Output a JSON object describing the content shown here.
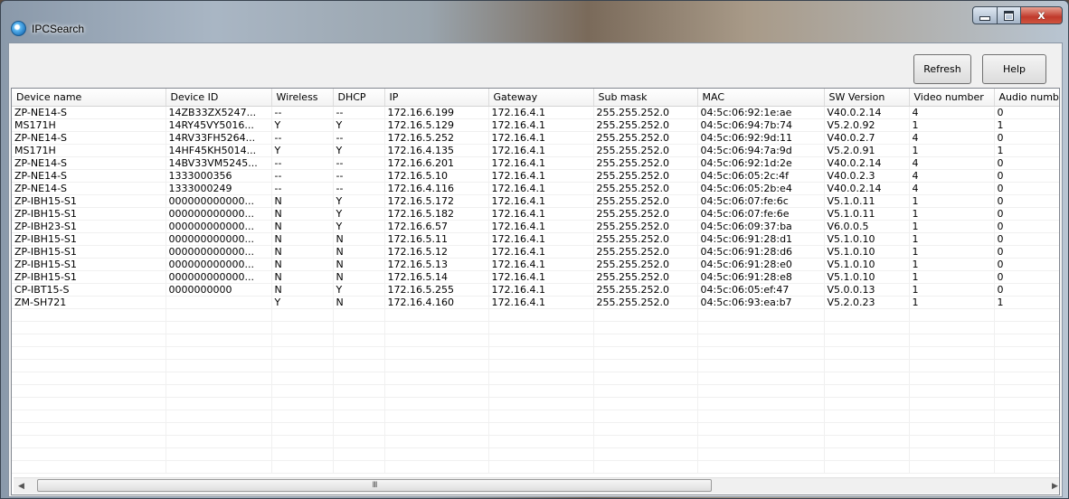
{
  "window": {
    "title": "IPCSearch",
    "close_glyph": "x"
  },
  "toolbar": {
    "refresh_label": "Refresh",
    "help_label": "Help"
  },
  "table": {
    "columns": [
      "Device name",
      "Device ID",
      "Wireless",
      "DHCP",
      "IP",
      "Gateway",
      "Sub mask",
      "MAC",
      "SW Version",
      "Video number",
      "Audio number"
    ],
    "rows": [
      [
        "ZP-NE14-S",
        "14ZB33ZX5247...",
        "--",
        "--",
        "172.16.6.199",
        "172.16.4.1",
        "255.255.252.0",
        "04:5c:06:92:1e:ae",
        "V40.0.2.14",
        "4",
        "0"
      ],
      [
        "MS171H",
        "14RY45VY5016...",
        "Y",
        "Y",
        "172.16.5.129",
        "172.16.4.1",
        "255.255.252.0",
        "04:5c:06:94:7b:74",
        "V5.2.0.92",
        "1",
        "1"
      ],
      [
        "ZP-NE14-S",
        "14RV33FH5264...",
        "--",
        "--",
        "172.16.5.252",
        "172.16.4.1",
        "255.255.252.0",
        "04:5c:06:92:9d:11",
        "V40.0.2.7",
        "4",
        "0"
      ],
      [
        "MS171H",
        "14HF45KH5014...",
        "Y",
        "Y",
        "172.16.4.135",
        "172.16.4.1",
        "255.255.252.0",
        "04:5c:06:94:7a:9d",
        "V5.2.0.91",
        "1",
        "1"
      ],
      [
        "ZP-NE14-S",
        "14BV33VM5245...",
        "--",
        "--",
        "172.16.6.201",
        "172.16.4.1",
        "255.255.252.0",
        "04:5c:06:92:1d:2e",
        "V40.0.2.14",
        "4",
        "0"
      ],
      [
        "ZP-NE14-S",
        "1333000356",
        "--",
        "--",
        "172.16.5.10",
        "172.16.4.1",
        "255.255.252.0",
        "04:5c:06:05:2c:4f",
        "V40.0.2.3",
        "4",
        "0"
      ],
      [
        "ZP-NE14-S",
        "1333000249",
        "--",
        "--",
        "172.16.4.116",
        "172.16.4.1",
        "255.255.252.0",
        "04:5c:06:05:2b:e4",
        "V40.0.2.14",
        "4",
        "0"
      ],
      [
        "ZP-IBH15-S1",
        "000000000000...",
        "N",
        "Y",
        "172.16.5.172",
        "172.16.4.1",
        "255.255.252.0",
        "04:5c:06:07:fe:6c",
        "V5.1.0.11",
        "1",
        "0"
      ],
      [
        "ZP-IBH15-S1",
        "000000000000...",
        "N",
        "Y",
        "172.16.5.182",
        "172.16.4.1",
        "255.255.252.0",
        "04:5c:06:07:fe:6e",
        "V5.1.0.11",
        "1",
        "0"
      ],
      [
        "ZP-IBH23-S1",
        "000000000000...",
        "N",
        "Y",
        "172.16.6.57",
        "172.16.4.1",
        "255.255.252.0",
        "04:5c:06:09:37:ba",
        "V6.0.0.5",
        "1",
        "0"
      ],
      [
        "ZP-IBH15-S1",
        "000000000000...",
        "N",
        "N",
        "172.16.5.11",
        "172.16.4.1",
        "255.255.252.0",
        "04:5c:06:91:28:d1",
        "V5.1.0.10",
        "1",
        "0"
      ],
      [
        "ZP-IBH15-S1",
        "000000000000...",
        "N",
        "N",
        "172.16.5.12",
        "172.16.4.1",
        "255.255.252.0",
        "04:5c:06:91:28:d6",
        "V5.1.0.10",
        "1",
        "0"
      ],
      [
        "ZP-IBH15-S1",
        "000000000000...",
        "N",
        "N",
        "172.16.5.13",
        "172.16.4.1",
        "255.255.252.0",
        "04:5c:06:91:28:e0",
        "V5.1.0.10",
        "1",
        "0"
      ],
      [
        "ZP-IBH15-S1",
        "000000000000...",
        "N",
        "N",
        "172.16.5.14",
        "172.16.4.1",
        "255.255.252.0",
        "04:5c:06:91:28:e8",
        "V5.1.0.10",
        "1",
        "0"
      ],
      [
        "CP-IBT15-S",
        "0000000000",
        "N",
        "Y",
        "172.16.5.255",
        "172.16.4.1",
        "255.255.252.0",
        "04:5c:06:05:ef:47",
        "V5.0.0.13",
        "1",
        "0"
      ],
      [
        "ZM-SH721",
        "",
        "Y",
        "N",
        "172.16.4.160",
        "172.16.4.1",
        "255.255.252.0",
        "04:5c:06:93:ea:b7",
        "V5.2.0.23",
        "1",
        "1"
      ]
    ],
    "empty_rows": 13
  },
  "scrollbar": {
    "left_arrow": "◀",
    "right_arrow": "▶",
    "grip": "III"
  },
  "icons": {
    "app": "ipcsearch-app-icon",
    "minimize": "minimize-icon",
    "maximize": "maximize-icon",
    "close": "close-icon"
  }
}
